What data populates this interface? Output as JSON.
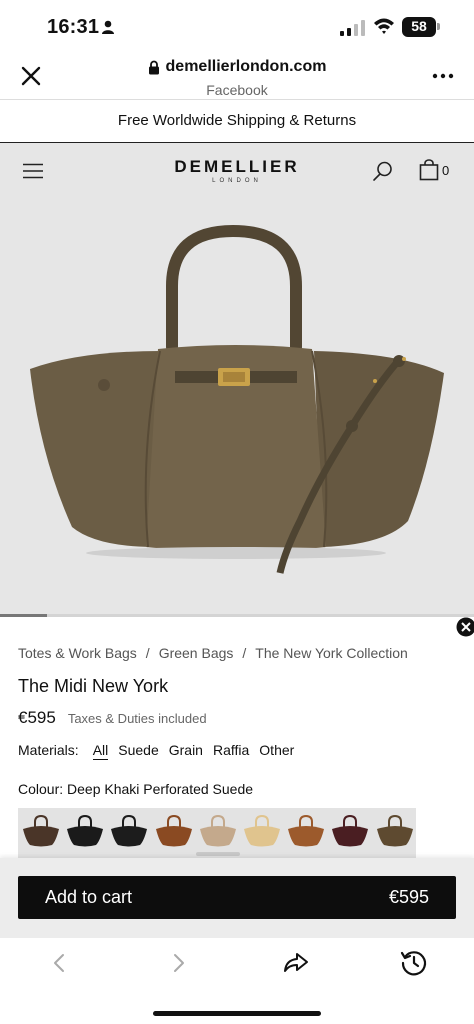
{
  "status_bar": {
    "time": "16:31",
    "battery": "58"
  },
  "browser": {
    "domain": "demellierlondon.com",
    "source": "Facebook"
  },
  "promo": {
    "text": "Free Worldwide Shipping & Returns"
  },
  "header": {
    "logo_main": "DEMELLIER",
    "logo_sub": "LONDON",
    "cart_count": "0"
  },
  "hero": {
    "gallery_progress": 0.1
  },
  "product": {
    "breadcrumb": [
      "Totes & Work Bags",
      "Green Bags",
      "The New York Collection"
    ],
    "title": "The Midi New York",
    "price": "€595",
    "tax_note": "Taxes & Duties included",
    "materials_label": "Materials:",
    "materials": [
      "All",
      "Suede",
      "Grain",
      "Raffia",
      "Other"
    ],
    "selected_material": "All",
    "colour_line": "Colour: Deep Khaki Perforated Suede",
    "swatch_colors": [
      "#4a3528",
      "#1a1a1a",
      "#1c1c1c",
      "#8a4a22",
      "#c4a98c",
      "#e0c48e",
      "#9c5a2c",
      "#4a1e22",
      "#5e4a30"
    ]
  },
  "cart_panel": {
    "button_label": "Add to cart",
    "button_price": "€595"
  },
  "colors": {
    "bag": "#6b5d45",
    "bag_dark": "#4e4432",
    "hardware": "#c9a24a"
  }
}
